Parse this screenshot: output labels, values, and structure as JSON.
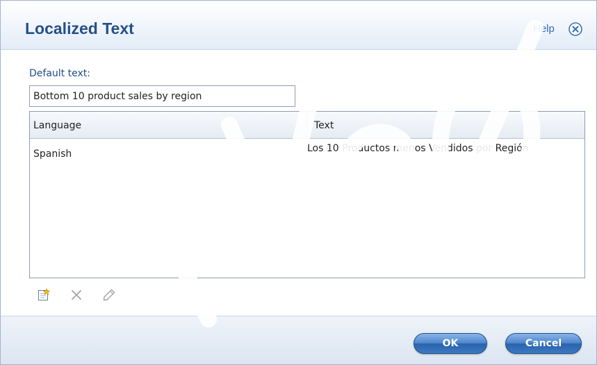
{
  "dialog": {
    "title": "Localized Text",
    "help_label": "Help",
    "close_icon": "close-circle-x"
  },
  "default_text": {
    "label": "Default text:",
    "value": "Bottom 10 product sales by region"
  },
  "grid": {
    "columns": [
      "Language",
      "Text"
    ],
    "rows": [
      {
        "language": "Spanish",
        "text": "Los 10 Productos menos Vendidos por Región"
      }
    ]
  },
  "toolbar": {
    "icons": [
      "add-icon",
      "delete-icon",
      "edit-icon"
    ]
  },
  "buttons": {
    "ok": "OK",
    "cancel": "Cancel"
  },
  "colors": {
    "title": "#24508a",
    "link": "#2f6cb3",
    "button": "#3c78c3"
  }
}
